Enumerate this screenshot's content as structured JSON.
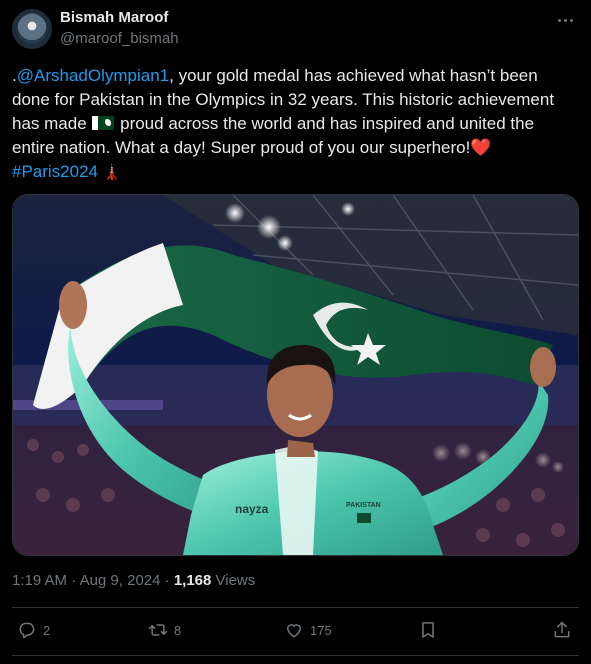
{
  "author": {
    "name": "Bismah Maroof",
    "handle": "@maroof_bismah"
  },
  "post": {
    "text_prefix": ".",
    "mention": "@ArshadOlympian1",
    "text_part1": ", your gold medal has achieved what hasn’t been done for Pakistan in the Olympics in 32 years. This historic achievement has made ",
    "flag_icon": "pakistan-flag-icon",
    "text_part2": " proud across the world and has inspired and united the entire nation. What a day! Super proud of you our superhero!",
    "heart": "❤️",
    "hashtag": "#Paris2024",
    "tower": "🗼"
  },
  "meta": {
    "time": "1:19 AM",
    "separator": " · ",
    "date": "Aug 9, 2024",
    "views_count": "1,168",
    "views_label": " Views"
  },
  "actions": {
    "replies": "2",
    "reposts": "8",
    "likes": "175"
  },
  "photo_text": {
    "jacket_brand": "nayza",
    "jacket_country": "PAKISTAN"
  },
  "colors": {
    "background": "#000000",
    "text": "#e7e9ea",
    "secondary": "#71767b",
    "link": "#1d9bf0",
    "border": "#2f3336",
    "flag_green": "#01411c",
    "jacket_teal": "#5fd0b8"
  }
}
